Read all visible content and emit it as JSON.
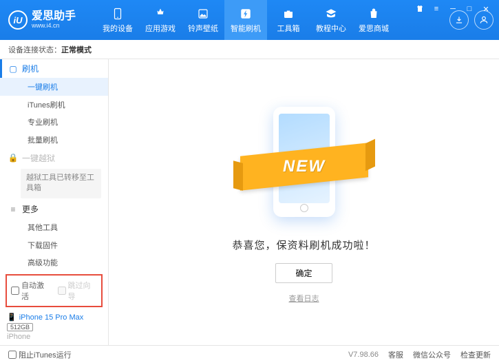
{
  "brand": {
    "name": "爱思助手",
    "url": "www.i4.cn",
    "logo_letter": "iU"
  },
  "nav": [
    {
      "id": "device",
      "label": "我的设备"
    },
    {
      "id": "apps",
      "label": "应用游戏"
    },
    {
      "id": "ringtone",
      "label": "铃声壁纸"
    },
    {
      "id": "flash",
      "label": "智能刷机"
    },
    {
      "id": "toolbox",
      "label": "工具箱"
    },
    {
      "id": "tutorial",
      "label": "教程中心"
    },
    {
      "id": "store",
      "label": "爱思商城"
    }
  ],
  "nav_active": "flash",
  "status": {
    "prefix": "设备连接状态：",
    "value": "正常模式"
  },
  "sidebar": {
    "groups": [
      {
        "id": "flash",
        "label": "刷机",
        "active": true,
        "icon": "monitor"
      },
      {
        "id": "jailbreak",
        "label": "一键越狱",
        "locked": true,
        "icon": "lock"
      },
      {
        "id": "more",
        "label": "更多",
        "icon": "menu"
      }
    ],
    "flash_items": [
      {
        "id": "onekey",
        "label": "一键刷机",
        "active": true
      },
      {
        "id": "itunes",
        "label": "iTunes刷机"
      },
      {
        "id": "pro",
        "label": "专业刷机"
      },
      {
        "id": "batch",
        "label": "批量刷机"
      }
    ],
    "jailbreak_note": "越狱工具已转移至工具箱",
    "more_items": [
      {
        "id": "other",
        "label": "其他工具"
      },
      {
        "id": "download",
        "label": "下载固件"
      },
      {
        "id": "advanced",
        "label": "高级功能"
      }
    ],
    "checkboxes": {
      "auto_activate": "自动激活",
      "skip_setup": "跳过向导"
    },
    "device": {
      "name": "iPhone 15 Pro Max",
      "storage": "512GB",
      "os": "iPhone"
    }
  },
  "main": {
    "ribbon": "NEW",
    "message": "恭喜您，保资料刷机成功啦！",
    "ok": "确定",
    "log_link": "查看日志"
  },
  "footer": {
    "block_itunes": "阻止iTunes运行",
    "version": "V7.98.66",
    "links": [
      "客服",
      "微信公众号",
      "检查更新"
    ]
  }
}
